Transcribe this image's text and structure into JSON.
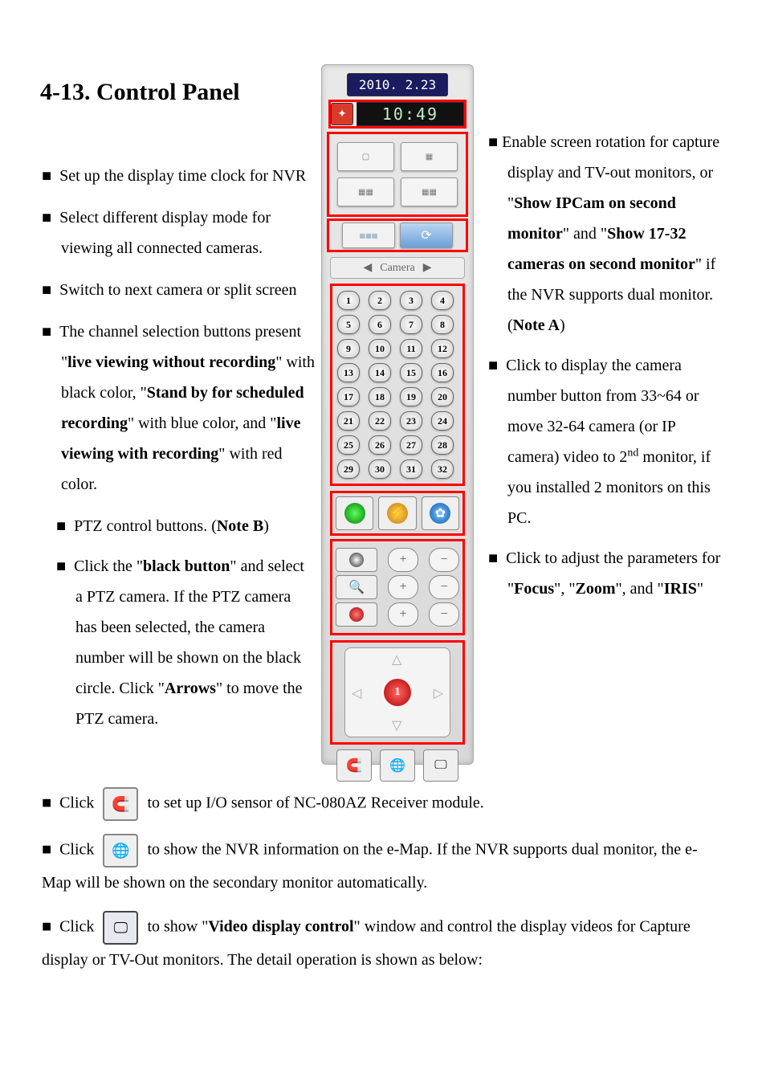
{
  "heading": "4-13. Control Panel",
  "left": {
    "i1": "Set up the display time clock for NVR",
    "i2": "Select different display mode for viewing all connected cameras.",
    "i3": "Switch to next camera or split screen",
    "i4_pre": "The channel selection buttons present \"",
    "i4_b1": "live viewing without recording",
    "i4_mid1": "\" with black color, \"",
    "i4_b2": "Stand by for scheduled recording",
    "i4_mid2": "\" with blue color, and \"",
    "i4_b3": "live viewing with recording",
    "i4_end": "\" with red color.",
    "i5_pre": "PTZ control buttons. (",
    "i5_b": "Note B",
    "i5_end": ")",
    "i6_pre": "Click the \"",
    "i6_b1": "black button",
    "i6_mid1": "\" and select a PTZ camera. If the PTZ camera has been selected, the camera number will be shown on the black circle. Click \"",
    "i6_b2": "Arrows",
    "i6_end": "\" to move the PTZ camera."
  },
  "right": {
    "r1_pre": "Enable screen rotation for capture display and TV-out monitors, or \"",
    "r1_b1": "Show IPCam on second monitor",
    "r1_mid1": "\" and \"",
    "r1_b2": "Show 17-32 cameras on second monitor",
    "r1_mid2": "\" if the NVR supports dual monitor. (",
    "r1_b3": "Note A",
    "r1_end": ")",
    "r2_pre": "Click to display the camera number button from 33~64 or move 32-64 camera (or IP camera) video to 2",
    "r2_sup": "nd",
    "r2_end": " monitor, if you installed 2 monitors on this PC.",
    "r3_pre": "Click to adjust the parameters for \"",
    "r3_b1": "Focus",
    "r3_mid1": "\", \"",
    "r3_b2": "Zoom",
    "r3_mid2": "\", and \"",
    "r3_b3": "IRIS",
    "r3_end": "\""
  },
  "panel": {
    "date": "2010. 2.23",
    "time": "10:49",
    "camera_label": "Camera",
    "channels": [
      "1",
      "2",
      "3",
      "4",
      "5",
      "6",
      "7",
      "8",
      "9",
      "10",
      "11",
      "12",
      "13",
      "14",
      "15",
      "16",
      "17",
      "18",
      "19",
      "20",
      "21",
      "22",
      "23",
      "24",
      "25",
      "26",
      "27",
      "28",
      "29",
      "30",
      "31",
      "32"
    ],
    "pad_center": "1"
  },
  "bottom": {
    "b1_pre": "Click ",
    "b1_post": " to set up I/O sensor of NC-080AZ Receiver module.",
    "b2_pre": "Click ",
    "b2_post": " to show the NVR information on the e-Map. If the NVR supports dual monitor, the e-Map will be shown on the secondary monitor automatically.",
    "b3_pre": "Click ",
    "b3_mid": " to show \"",
    "b3_b": "Video display control",
    "b3_post": "\" window and control the display videos for Capture display or TV-Out monitors. The detail operation is shown as below:"
  },
  "bullet": "■"
}
